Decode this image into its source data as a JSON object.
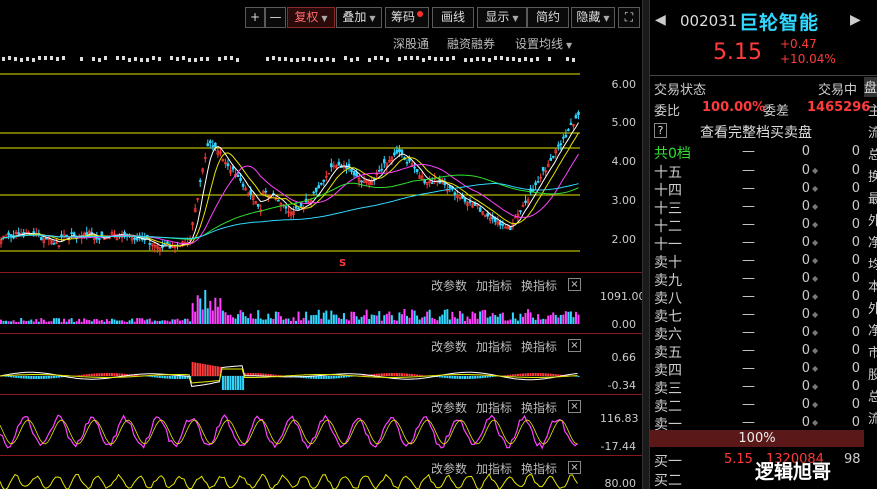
{
  "toolbar": {
    "plus": "+",
    "minus": "—",
    "fuquan": "复权",
    "diejia": "叠加",
    "chouma": "筹码",
    "huaxian": "画线",
    "xianshi": "显示",
    "jianyue": "简约",
    "yincang": "隐藏",
    "fullscreen": "⛶"
  },
  "sublinks": {
    "shenguantong": "深股通",
    "rongzi": "融资融券",
    "junxian": "设置均线"
  },
  "yaxis": {
    "main": [
      "6.00",
      "5.00",
      "4.00",
      "3.00",
      "2.00"
    ],
    "vol": [
      "1091.00",
      "0.00"
    ],
    "macd": [
      "0.66",
      "-0.34"
    ],
    "ind3": [
      "116.83",
      "-17.44"
    ],
    "ind4": [
      "80.00"
    ]
  },
  "panel_buttons": {
    "gaicanshu": "改参数",
    "jiazhibiao": "加指标",
    "huanzhibiao": "换指标",
    "close": "×"
  },
  "markers": {
    "s_marker": "S"
  },
  "stock": {
    "code": "002031",
    "name": "巨轮智能",
    "price": "5.15",
    "change": "+0.47",
    "change_pct": "+10.04%",
    "status_label": "交易状态",
    "status_value": "交易中",
    "panel_edge": "盘",
    "weibi_label": "委比",
    "weibi_value": "100.00%",
    "weicha_label": "委差",
    "weicha_value": "1465296",
    "help": "?",
    "full_book": "查看完整档买卖盘",
    "total_levels": "共0档",
    "pct_bar": "100%",
    "buy1_label": "买一",
    "buy1_price": "5.15",
    "buy1_vol": "1320084",
    "buy1_dir": "98",
    "buy2_label": "买二"
  },
  "orderbook": [
    {
      "label": "十五",
      "dash": "—",
      "v1": "0",
      "v2": "0"
    },
    {
      "label": "十四",
      "dash": "—",
      "v1": "0",
      "v2": "0"
    },
    {
      "label": "十三",
      "dash": "—",
      "v1": "0",
      "v2": "0"
    },
    {
      "label": "十二",
      "dash": "—",
      "v1": "0",
      "v2": "0"
    },
    {
      "label": "十一",
      "dash": "—",
      "v1": "0",
      "v2": "0"
    },
    {
      "label": "卖十",
      "dash": "—",
      "v1": "0",
      "v2": "0"
    },
    {
      "label": "卖九",
      "dash": "—",
      "v1": "0",
      "v2": "0"
    },
    {
      "label": "卖八",
      "dash": "—",
      "v1": "0",
      "v2": "0"
    },
    {
      "label": "卖七",
      "dash": "—",
      "v1": "0",
      "v2": "0"
    },
    {
      "label": "卖六",
      "dash": "—",
      "v1": "0",
      "v2": "0"
    },
    {
      "label": "卖五",
      "dash": "—",
      "v1": "0",
      "v2": "0"
    },
    {
      "label": "卖四",
      "dash": "—",
      "v1": "0",
      "v2": "0"
    },
    {
      "label": "卖三",
      "dash": "—",
      "v1": "0",
      "v2": "0"
    },
    {
      "label": "卖二",
      "dash": "—",
      "v1": "0",
      "v2": "0"
    },
    {
      "label": "卖一",
      "dash": "—",
      "v1": "0",
      "v2": "0"
    }
  ],
  "edge_chars": [
    "主",
    "流",
    "总",
    "换",
    "最",
    "外",
    "净",
    "均",
    "本",
    "外",
    "净",
    "市",
    "股",
    "总",
    "流"
  ],
  "watermark": "逻辑旭哥",
  "colors": {
    "up": "#ff3b3b",
    "down": "#30d7ff",
    "yellow_line": "#e6e600",
    "name": "#30d7ff",
    "grid_red": "#8a1a1a"
  }
}
